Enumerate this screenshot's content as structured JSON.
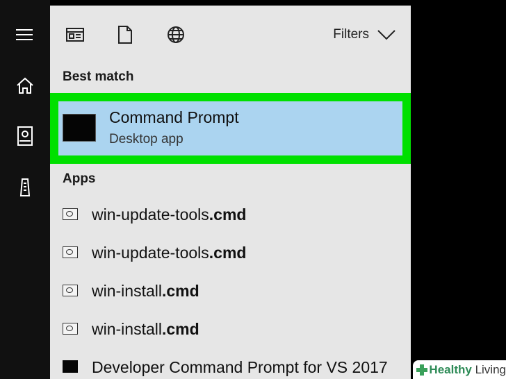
{
  "sidebar": {
    "items": [
      {
        "name": "menu-icon"
      },
      {
        "name": "home-icon"
      },
      {
        "name": "documents-icon"
      },
      {
        "name": "device-icon"
      }
    ]
  },
  "toolbar": {
    "filters_label": "Filters"
  },
  "best_match": {
    "heading": "Best match",
    "title": "Command Prompt",
    "subtitle": "Desktop app",
    "highlight_color": "#00e000",
    "selected_color": "#abd4f0"
  },
  "apps": {
    "heading": "Apps",
    "items": [
      {
        "name_prefix": "win-update-tools",
        "name_ext": ".cmd",
        "icon": "script-icon"
      },
      {
        "name_prefix": "win-update-tools",
        "name_ext": ".cmd",
        "icon": "script-icon"
      },
      {
        "name_prefix": "win-install",
        "name_ext": ".cmd",
        "icon": "script-icon"
      },
      {
        "name_prefix": "win-install",
        "name_ext": ".cmd",
        "icon": "script-icon"
      },
      {
        "name_prefix": "Developer Command Prompt for VS 2017",
        "name_ext": "",
        "icon": "console-icon"
      }
    ]
  },
  "watermark": {
    "brand_1": "Healthy",
    "brand_2": "Living"
  }
}
